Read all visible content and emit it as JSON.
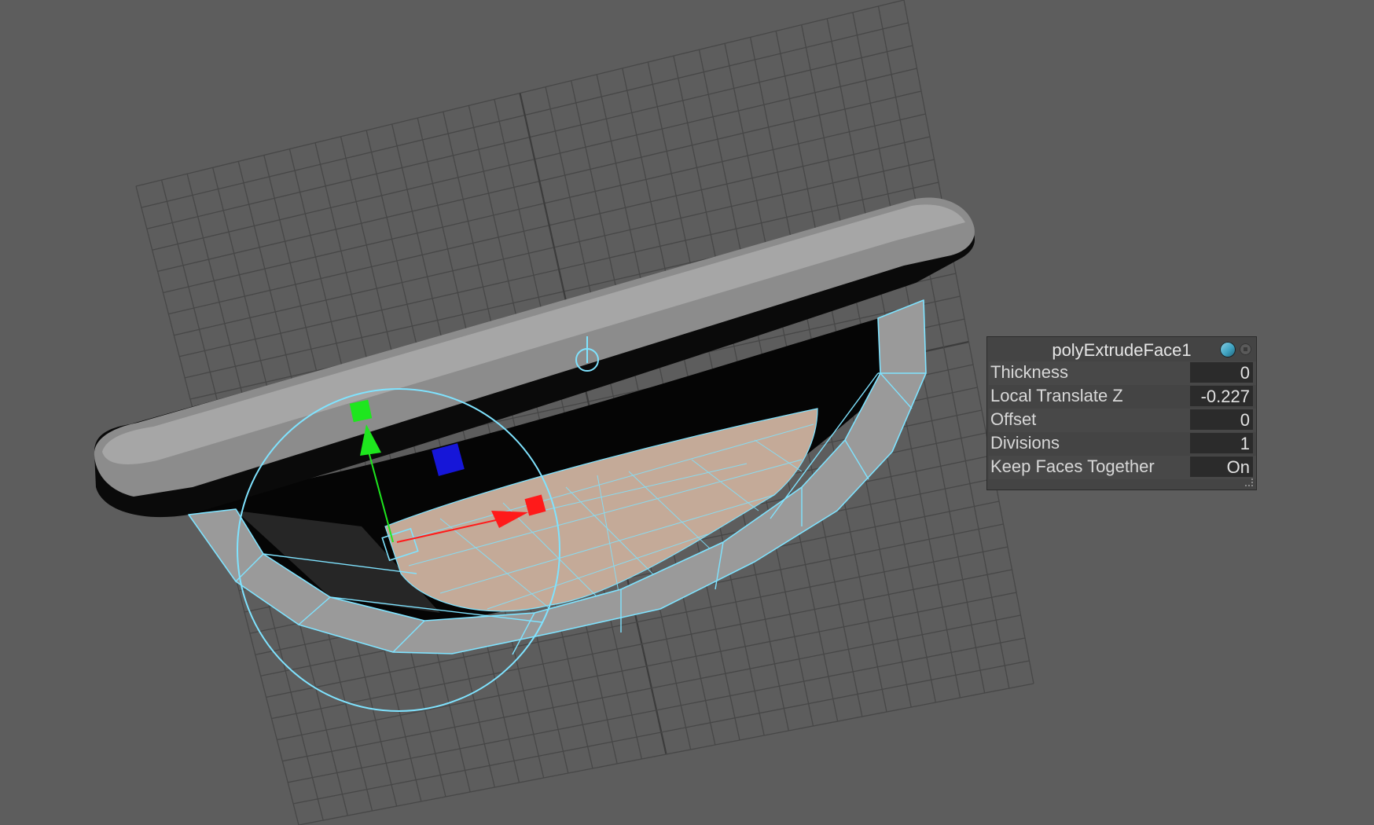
{
  "viewport": {
    "background_color": "#5d5d5d",
    "grid_color": "#474747",
    "selection_color": "#7fe3ff",
    "manipulator_axes": {
      "x_color": "#ff1a1a",
      "y_color": "#1ee61e",
      "z_color": "#1616d8"
    }
  },
  "inview_editor": {
    "title": "polyExtrudeFace1",
    "attributes": [
      {
        "label": "Thickness",
        "value": "0"
      },
      {
        "label": "Local Translate Z",
        "value": "-0.227"
      },
      {
        "label": "Offset",
        "value": "0"
      },
      {
        "label": "Divisions",
        "value": "1"
      },
      {
        "label": "Keep Faces Together",
        "value": "On"
      }
    ],
    "icons": {
      "pin": "pin-toggle-icon",
      "close": "close-icon",
      "resize": "resize-grip-icon"
    }
  }
}
